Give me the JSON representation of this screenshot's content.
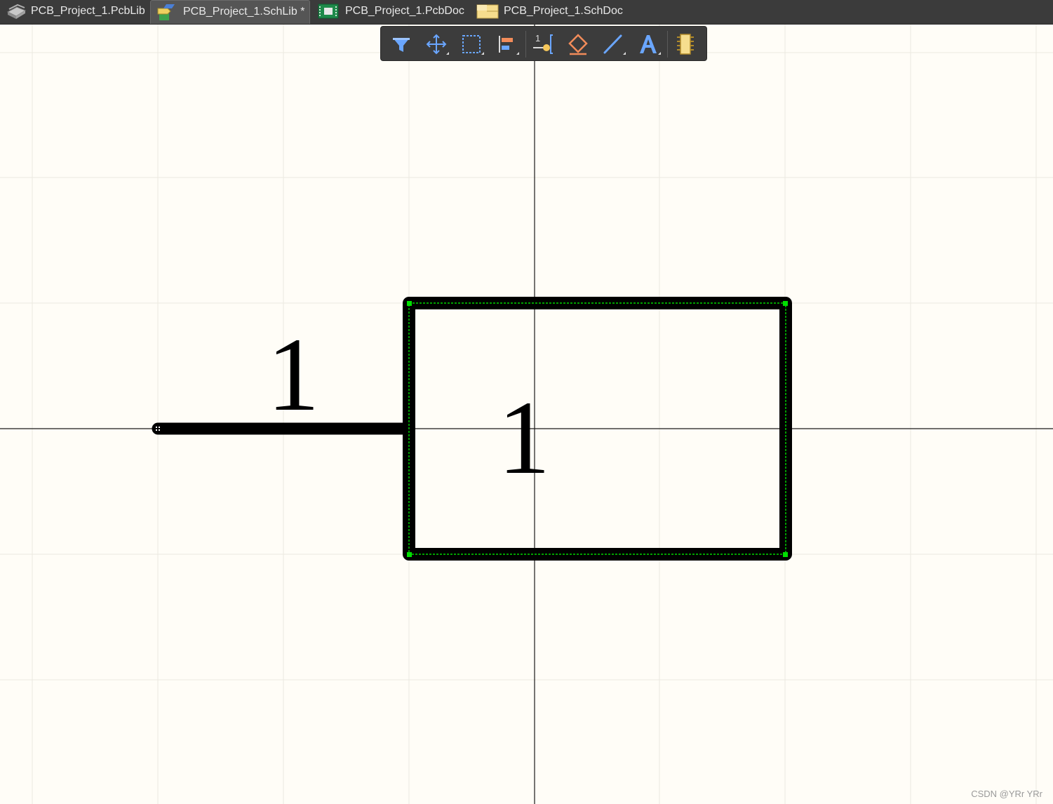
{
  "tabs": [
    {
      "label": "PCB_Project_1.PcbLib",
      "icon": "pcblib-icon",
      "active": false
    },
    {
      "label": "PCB_Project_1.SchLib *",
      "icon": "schlib-icon",
      "active": true
    },
    {
      "label": "PCB_Project_1.PcbDoc",
      "icon": "pcbdoc-icon",
      "active": false
    },
    {
      "label": "PCB_Project_1.SchDoc",
      "icon": "schdoc-icon",
      "active": false
    }
  ],
  "toolbar": {
    "buttons": [
      {
        "icon": "filter-icon"
      },
      {
        "icon": "move-icon"
      },
      {
        "icon": "select-area-icon"
      },
      {
        "icon": "align-icon"
      },
      {
        "icon": "place-pin-icon"
      },
      {
        "icon": "place-ieee-symbol-icon"
      },
      {
        "icon": "place-line-icon"
      },
      {
        "icon": "place-text-icon"
      },
      {
        "icon": "add-component-icon"
      }
    ]
  },
  "schematic": {
    "pin_designator": "1",
    "body_label": "1"
  },
  "colors": {
    "tabbar_bg": "#3b3b3b",
    "toolbar_bg": "#3c3c3c",
    "canvas_bg": "#fffdf7",
    "grid": "#ebe9e1",
    "axis": "#1a1a1a",
    "stroke": "#000000",
    "selection": "#00ff00",
    "icon_blue": "#6aa6ff",
    "icon_orange": "#f28c5a"
  },
  "watermark": "CSDN @YRr YRr"
}
